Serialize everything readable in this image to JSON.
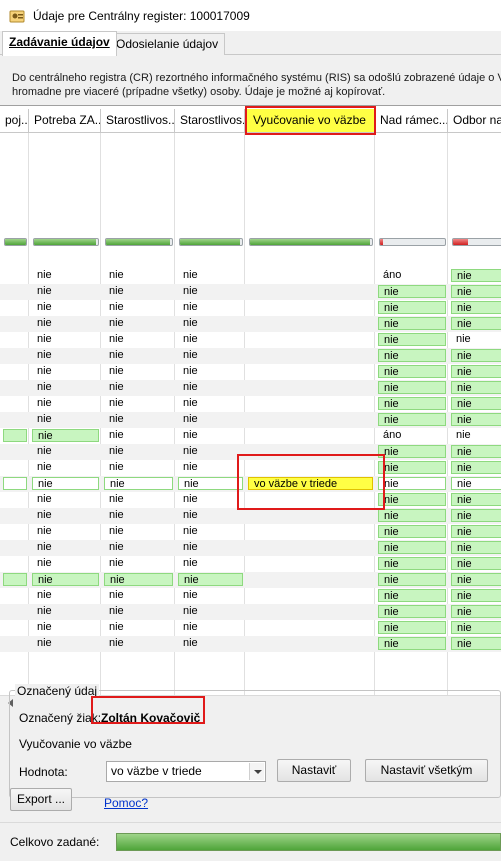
{
  "window": {
    "title": "Údaje pre Centrálny register: 100017009"
  },
  "tabs": [
    {
      "label": "Zadávanie údajov",
      "active": true
    },
    {
      "label": "Odosielanie údajov",
      "active": false
    }
  ],
  "description": {
    "line1": "Do centrálneho registra (CR) rezortného informačného systému (RIS) sa odošlú zobrazené údaje o V",
    "line2": "hromadne pre viaceré (prípadne všetky) osoby. Údaje je možné aj kopírovať."
  },
  "grid": {
    "headers": [
      "poj...",
      "Potreba ZA...",
      "Starostlivos...",
      "Starostlivos...",
      "Vyučovanie vo väzbe",
      "Nad rámec...",
      "Odbor na"
    ],
    "progress": [
      {
        "kind": "green",
        "fill": 1.0
      },
      {
        "kind": "green",
        "fill": 0.97
      },
      {
        "kind": "green",
        "fill": 0.97
      },
      {
        "kind": "green",
        "fill": 0.97
      },
      {
        "kind": "green",
        "fill": 0.98
      },
      {
        "kind": "red",
        "fill": 0.05
      },
      {
        "kind": "red",
        "fill": 0.28
      }
    ],
    "rows": [
      {
        "c1": "nie",
        "c2": "nie",
        "c3": "nie",
        "c5": "áno",
        "c6": "nie",
        "g5": false,
        "g6": true
      },
      {
        "c1": "nie",
        "c2": "nie",
        "c3": "nie",
        "c5": "nie",
        "c6": "nie",
        "g5": true,
        "g6": true
      },
      {
        "c1": "nie",
        "c2": "nie",
        "c3": "nie",
        "c5": "nie",
        "c6": "nie",
        "g5": true,
        "g6": true
      },
      {
        "c1": "nie",
        "c2": "nie",
        "c3": "nie",
        "c5": "nie",
        "c6": "nie",
        "g5": true,
        "g6": true
      },
      {
        "c1": "nie",
        "c2": "nie",
        "c3": "nie",
        "c5": "nie",
        "c6": "nie",
        "g5": true,
        "g6": false
      },
      {
        "c1": "nie",
        "c2": "nie",
        "c3": "nie",
        "c5": "nie",
        "c6": "nie",
        "g5": true,
        "g6": true
      },
      {
        "c1": "nie",
        "c2": "nie",
        "c3": "nie",
        "c5": "nie",
        "c6": "nie",
        "g5": true,
        "g6": true
      },
      {
        "c1": "nie",
        "c2": "nie",
        "c3": "nie",
        "c5": "nie",
        "c6": "nie",
        "g5": true,
        "g6": true
      },
      {
        "c1": "nie",
        "c2": "nie",
        "c3": "nie",
        "c5": "nie",
        "c6": "nie",
        "g5": true,
        "g6": true
      },
      {
        "c1": "nie",
        "c2": "nie",
        "c3": "nie",
        "c5": "nie",
        "c6": "nie",
        "g5": true,
        "g6": true
      },
      {
        "c1": "nie",
        "c2": "nie",
        "c3": "nie",
        "c5": "áno",
        "c6": "nie",
        "g1": true,
        "g5": false,
        "g6": false,
        "gp": true
      },
      {
        "c1": "nie",
        "c2": "nie",
        "c3": "nie",
        "c5": "nie",
        "c6": "nie",
        "g5": true,
        "g6": true
      },
      {
        "c1": "nie",
        "c2": "nie",
        "c3": "nie",
        "c5": "nie",
        "c6": "nie",
        "g5": true,
        "g6": true
      },
      {
        "c1": "nie",
        "c2": "nie",
        "c3": "nie",
        "c4": "vo väzbe v triede",
        "c5": "nie",
        "c6": "nie",
        "sel": true
      },
      {
        "c1": "nie",
        "c2": "nie",
        "c3": "nie",
        "c5": "nie",
        "c6": "nie",
        "g5": true,
        "g6": true
      },
      {
        "c1": "nie",
        "c2": "nie",
        "c3": "nie",
        "c5": "nie",
        "c6": "nie",
        "g5": true,
        "g6": true
      },
      {
        "c1": "nie",
        "c2": "nie",
        "c3": "nie",
        "c5": "nie",
        "c6": "nie",
        "g5": true,
        "g6": true
      },
      {
        "c1": "nie",
        "c2": "nie",
        "c3": "nie",
        "c5": "nie",
        "c6": "nie",
        "g5": true,
        "g6": true
      },
      {
        "c1": "nie",
        "c2": "nie",
        "c3": "nie",
        "c5": "nie",
        "c6": "nie",
        "g5": true,
        "g6": true
      },
      {
        "c1": "nie",
        "c2": "nie",
        "c3": "nie",
        "c5": "nie",
        "c6": "nie",
        "g1": true,
        "g2": true,
        "g3": true,
        "g5": true,
        "g6": true,
        "gp": true
      },
      {
        "c1": "nie",
        "c2": "nie",
        "c3": "nie",
        "c5": "nie",
        "c6": "nie",
        "g5": true,
        "g6": true
      },
      {
        "c1": "nie",
        "c2": "nie",
        "c3": "nie",
        "c5": "nie",
        "c6": "nie",
        "g5": true,
        "g6": true
      },
      {
        "c1": "nie",
        "c2": "nie",
        "c3": "nie",
        "c5": "nie",
        "c6": "nie",
        "g5": true,
        "g6": true
      },
      {
        "c1": "nie",
        "c2": "nie",
        "c3": "nie",
        "c5": "nie",
        "c6": "nie",
        "g5": true,
        "g6": true
      }
    ]
  },
  "selected": {
    "group_title": "Označený údaj",
    "student_label": "Označený žiak:",
    "student_name": "Zoltán Kovačovič",
    "field_name": "Vyučovanie vo väzbe",
    "value_label": "Hodnota:",
    "value": "vo väzbe v triede",
    "set_button": "Nastaviť",
    "set_all_button": "Nastaviť všetkým"
  },
  "footer": {
    "export_button": "Export ...",
    "help_link": "Pomoc?",
    "total_label": "Celkovo zadané:",
    "total_fill": 1.0
  },
  "colors": {
    "green_cell": "#c8f5c0",
    "highlight_yellow": "#ffff44",
    "annotation_red": "#e01a1a"
  }
}
